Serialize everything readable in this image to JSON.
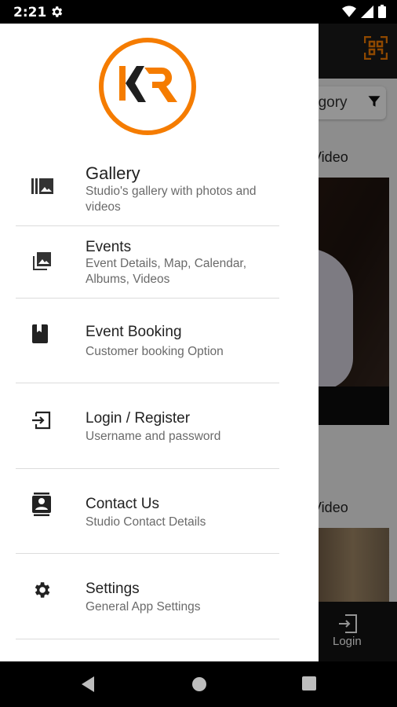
{
  "status_bar": {
    "time": "2:21"
  },
  "background": {
    "category_label": "egory",
    "video_label_1": "Video",
    "video_label_2": "Video",
    "login_label": "Login"
  },
  "drawer": {
    "items": [
      {
        "title": "Gallery",
        "subtitle": "Studio's gallery with photos and videos",
        "icon": "gallery-icon"
      },
      {
        "title": "Events",
        "subtitle": "Event Details, Map, Calendar, Albums, Videos",
        "icon": "photo-library-icon"
      },
      {
        "title": "Event Booking",
        "subtitle": "Customer booking Option",
        "icon": "book-icon"
      },
      {
        "title": "Login / Register",
        "subtitle": "Username and password",
        "icon": "login-icon"
      },
      {
        "title": "Contact Us",
        "subtitle": "Studio Contact Details",
        "icon": "contact-card-icon"
      },
      {
        "title": "Settings",
        "subtitle": "General App Settings",
        "icon": "settings-gear-icon"
      }
    ]
  },
  "colors": {
    "brand_orange": "#F57C00",
    "drawer_bg": "#FFFFFF",
    "scrim": "#000000"
  }
}
